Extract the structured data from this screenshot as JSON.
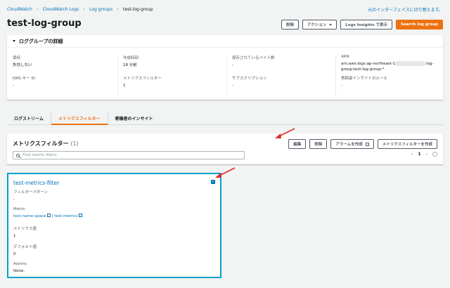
{
  "breadcrumb": [
    "CloudWatch",
    "CloudWatch Logs",
    "Log groups",
    "test-log-group"
  ],
  "revert_link": "元のインターフェイスに切り替えます。",
  "page_title": "test-log-group",
  "header_buttons": {
    "delete": "削除",
    "actions": "アクション",
    "insights": "Logs Insights で表示",
    "search": "Search log group"
  },
  "details": {
    "title": "ロググループの詳細",
    "retention_label": "保持",
    "retention_value": "失効しない",
    "kms_label": "KMS キー ID",
    "kms_value": "-",
    "created_label": "作成時刻",
    "created_value": "18 分前",
    "metric_filters_label": "メトリクスフィルター",
    "metric_filters_value": "1",
    "stored_bytes_label": "保存されているバイト数",
    "stored_bytes_value": "-",
    "subscription_label": "サブスクリプション",
    "subscription_value": "-",
    "arn_label": "ARN",
    "arn_prefix": "arn:aws:logs:ap-northeast-1:",
    "arn_suffix": ":log-",
    "arn_line2": "group:test-log-group:*",
    "contributor_label": "寄稿者インサイトのルール",
    "contributor_value": "-"
  },
  "tabs": [
    "ログストリーム",
    "メトリクスフィルター",
    "寄稿者のインサイト"
  ],
  "metric_filters": {
    "title": "メトリクスフィルター",
    "count": "(1)",
    "edit": "編集",
    "delete": "削除",
    "create_alarm": "アラームを作成",
    "create_filter": "メトリクスフィルターを作成",
    "search_placeholder": "Find metric filters",
    "page": "1"
  },
  "card": {
    "name": "test-metrics-filter",
    "pattern_label": "フィルターパターン",
    "pattern_value": "-",
    "metric_label": "Metric",
    "metric_namespace": "test-name-space",
    "metric_sep": "/",
    "metric_name": "test-metrics",
    "metric_value_label": "メトリクス値",
    "metric_value": "1",
    "default_label": "デフォルト値",
    "default_value": "0",
    "alarms_label": "Alarms",
    "alarms_value": "None."
  },
  "colors": {
    "accent": "#ec7211",
    "link": "#0073bb",
    "annotation": "#e02b2b"
  }
}
